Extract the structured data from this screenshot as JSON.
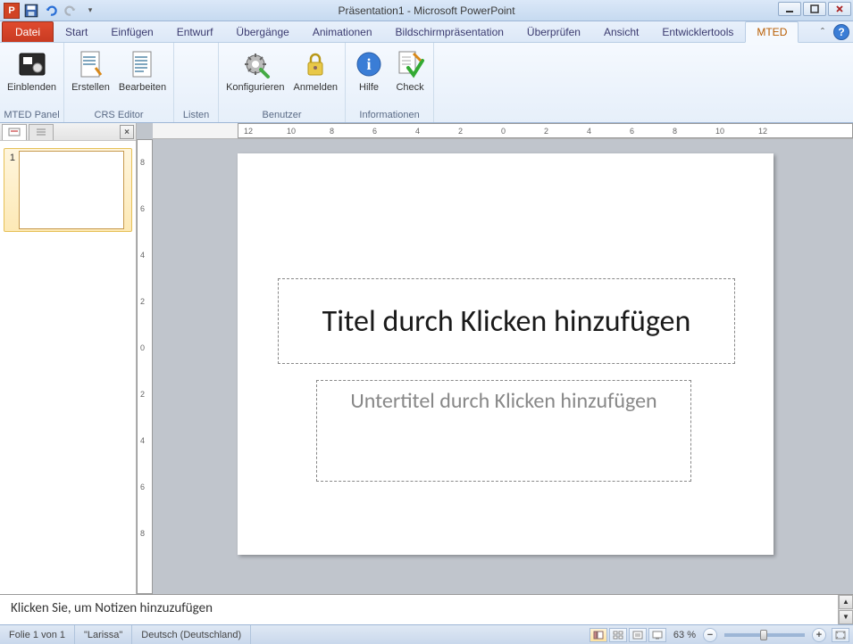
{
  "titlebar": {
    "app_icon_letter": "P",
    "title": "Präsentation1 - Microsoft PowerPoint"
  },
  "tabs": {
    "file": "Datei",
    "items": [
      "Start",
      "Einfügen",
      "Entwurf",
      "Übergänge",
      "Animationen",
      "Bildschirmpräsentation",
      "Überprüfen",
      "Ansicht",
      "Entwicklertools",
      "MTED"
    ],
    "active_index": 9,
    "help": "?"
  },
  "ribbon": {
    "groups": [
      {
        "label": "MTED Panel",
        "buttons": [
          {
            "label": "Einblenden",
            "icon": "panel"
          }
        ]
      },
      {
        "label": "CRS Editor",
        "buttons": [
          {
            "label": "Erstellen",
            "icon": "new-doc"
          },
          {
            "label": "Bearbeiten",
            "icon": "edit-doc"
          }
        ]
      },
      {
        "label": "Listen",
        "buttons": []
      },
      {
        "label": "Benutzer",
        "buttons": [
          {
            "label": "Konfigurieren",
            "icon": "gear"
          },
          {
            "label": "Anmelden",
            "icon": "lock"
          }
        ]
      },
      {
        "label": "Informationen",
        "buttons": [
          {
            "label": "Hilfe",
            "icon": "info"
          },
          {
            "label": "Check",
            "icon": "check"
          }
        ]
      }
    ]
  },
  "slide_panel": {
    "slides": [
      {
        "number": "1"
      }
    ]
  },
  "slide": {
    "title_placeholder": "Titel durch Klicken hinzufügen",
    "subtitle_placeholder": "Untertitel durch Klicken hinzufügen"
  },
  "notes": {
    "placeholder": "Klicken Sie, um Notizen hinzuzufügen"
  },
  "ruler": {
    "h_ticks": [
      "12",
      "10",
      "8",
      "6",
      "4",
      "2",
      "0",
      "2",
      "4",
      "6",
      "8",
      "10",
      "12"
    ],
    "v_ticks": [
      "8",
      "6",
      "4",
      "2",
      "0",
      "2",
      "4",
      "6",
      "8"
    ]
  },
  "statusbar": {
    "slide_info": "Folie 1 von 1",
    "theme": "\"Larissa\"",
    "language": "Deutsch (Deutschland)",
    "zoom": "63 %"
  }
}
